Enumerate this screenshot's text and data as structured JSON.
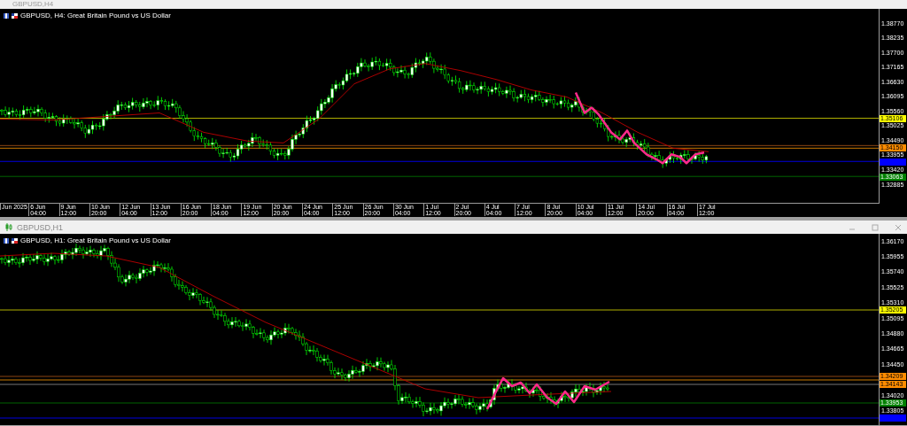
{
  "windows": [
    {
      "title": "GBPUSD,H4",
      "chart_caption": "GBPUSD, H4:  Great Britain Pound vs US Dollar",
      "price_ticks": [
        "1.38770",
        "1.38235",
        "1.37700",
        "1.37165",
        "1.36630",
        "1.36095",
        "1.35560",
        "1.35025",
        "1.34490",
        "1.33955",
        "1.33420",
        "1.32885"
      ],
      "level_tags": [
        {
          "text": "1.35106",
          "color": "#ffff00"
        },
        {
          "text": "1.34150",
          "color": "#ff8c00"
        },
        {
          "color": "#0000ff"
        },
        {
          "text": "1.33063",
          "color": "#008000"
        }
      ],
      "time_ticks": [
        "Jun 2025",
        "6 Jun 04:00",
        "9 Jun 12:00",
        "10 Jun 20:00",
        "12 Jun 04:00",
        "13 Jun 12:00",
        "16 Jun 20:00",
        "18 Jun 04:00",
        "19 Jun 12:00",
        "20 Jun 20:00",
        "24 Jun 04:00",
        "25 Jun 12:00",
        "26 Jun 20:00",
        "30 Jun 04:00",
        "1 Jul 12:00",
        "2 Jul 20:00",
        "4 Jul 04:00",
        "7 Jul 12:00",
        "8 Jul 20:00",
        "10 Jul 04:00",
        "11 Jul 12:00",
        "14 Jul 20:00",
        "16 Jul 04:00",
        "17 Jul 12:00"
      ]
    },
    {
      "title": "GBPUSD,H1",
      "chart_caption": "GBPUSD, H1:  Great Britain Pound vs US Dollar",
      "price_ticks": [
        "1.36170",
        "1.35955",
        "1.35740",
        "1.35525",
        "1.35310",
        "1.35095",
        "1.34880",
        "1.34665",
        "1.34450",
        "1.34020",
        "1.33805"
      ],
      "level_tags": [
        {
          "text": "1.35205",
          "color": "#ffff00"
        },
        {
          "text": "1.34209",
          "color": "#ff8c00"
        },
        {
          "text": "1.34143",
          "color": "#ff8c00"
        },
        {
          "text": "1.33953",
          "color": "#008000"
        },
        {
          "color": "#0000ff"
        }
      ]
    }
  ]
}
